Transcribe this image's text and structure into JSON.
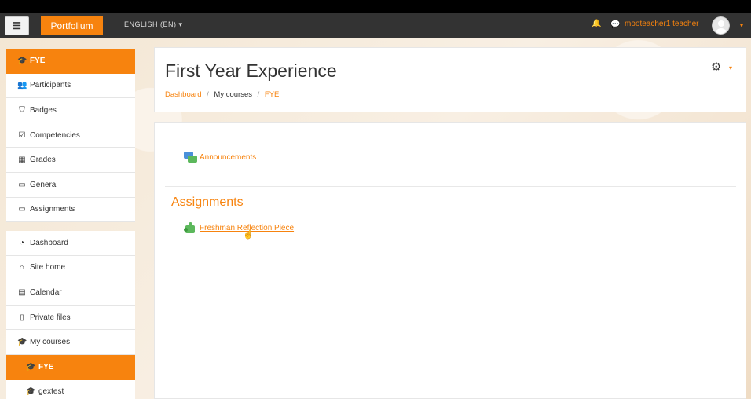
{
  "navbar": {
    "menu_icon": "hamburger-icon",
    "brand": "Portfolium",
    "language": "ENGLISH (EN)",
    "language_caret": "▾",
    "username": "mooteacher1 teacher",
    "user_caret": "▾"
  },
  "course_nav": [
    {
      "label": "FYE",
      "icon": "graduation-cap-icon",
      "active": true
    },
    {
      "label": "Participants",
      "icon": "users-icon"
    },
    {
      "label": "Badges",
      "icon": "shield-icon"
    },
    {
      "label": "Competencies",
      "icon": "checkbox-icon"
    },
    {
      "label": "Grades",
      "icon": "table-icon"
    },
    {
      "label": "General",
      "icon": "folder-icon"
    },
    {
      "label": "Assignments",
      "icon": "folder-icon"
    }
  ],
  "site_nav": [
    {
      "label": "Dashboard",
      "icon": "dashboard-icon"
    },
    {
      "label": "Site home",
      "icon": "home-icon"
    },
    {
      "label": "Calendar",
      "icon": "calendar-icon"
    },
    {
      "label": "Private files",
      "icon": "file-icon"
    },
    {
      "label": "My courses",
      "icon": "graduation-cap-icon"
    },
    {
      "label": "FYE",
      "icon": "graduation-cap-icon",
      "active": true
    },
    {
      "label": "gextest",
      "icon": "graduation-cap-icon"
    }
  ],
  "header": {
    "title": "First Year Experience",
    "breadcrumb": [
      "Dashboard",
      "My courses",
      "FYE"
    ],
    "breadcrumb_sep": "/"
  },
  "main": {
    "announcements": "Announcements",
    "section_title": "Assignments",
    "assignment": "Freshman Reflection Piece"
  },
  "colors": {
    "accent": "#f7830e",
    "navbar": "#333333"
  }
}
